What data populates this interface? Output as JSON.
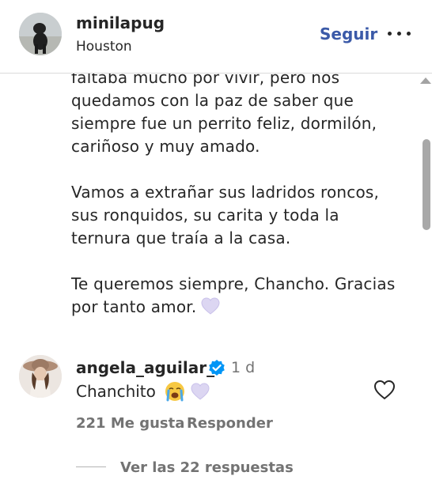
{
  "header": {
    "username": "minilapug",
    "location": "Houston",
    "follow_label": "Seguir",
    "more_icon": "more-horizontal-icon"
  },
  "caption": {
    "line1": "faltaba mucho por vivir, pero nos",
    "line2": "quedamos con la paz de saber que",
    "line3": "siempre fue un perrito feliz, dormilón,",
    "line4": "cariñoso y muy amado.",
    "para2": "Vamos a extrañar sus ladridos roncos, sus ronquidos, su carita y toda la ternura que traía a la casa.",
    "para3": "Te queremos siempre, Chancho. Gracias por tanto amor.",
    "heart_color": "#dcd6f2"
  },
  "comment": {
    "username": "angela_aguilar_",
    "time": "1 d",
    "text": "Chanchito",
    "emoji_1": "crying-face-icon",
    "emoji_2": "white-heart-icon",
    "likes": "221 Me gusta",
    "reply_label": "Responder",
    "view_replies": "Ver las 22 respuestas",
    "verified_color": "#0095f6"
  },
  "colors": {
    "link_blue": "#3b5aa8",
    "text": "#262626",
    "muted": "#737373"
  }
}
